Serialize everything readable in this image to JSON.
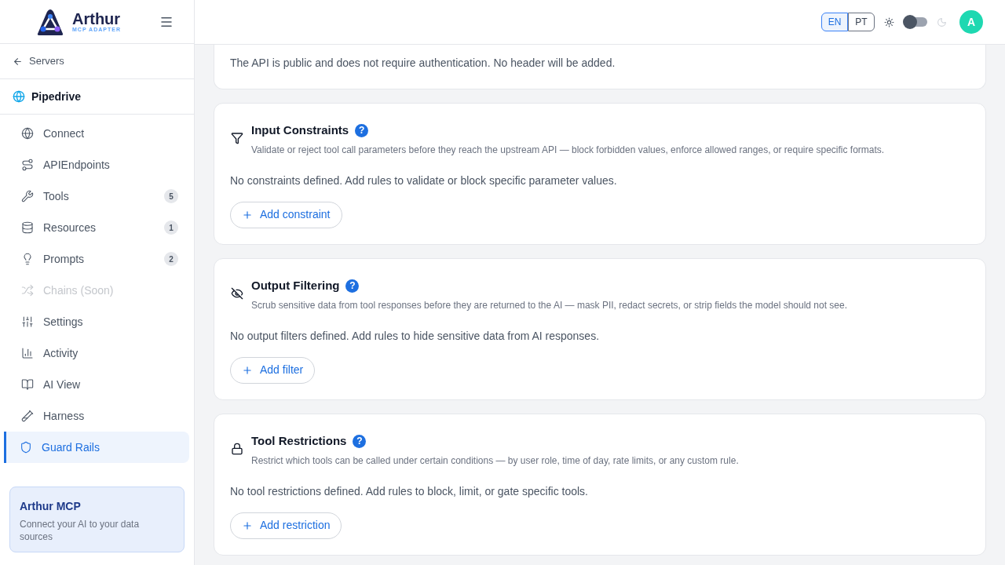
{
  "brand": {
    "name": "Arthur",
    "tagline": "MCP ADAPTER"
  },
  "back_link": "Servers",
  "server": {
    "name": "Pipedrive"
  },
  "nav": [
    {
      "label": "Connect",
      "selected": false,
      "disabled": false
    },
    {
      "label": "APIEndpoints",
      "selected": false,
      "disabled": false
    },
    {
      "label": "Tools",
      "count": "5",
      "selected": false,
      "disabled": false
    },
    {
      "label": "Resources",
      "count": "1",
      "selected": false,
      "disabled": false
    },
    {
      "label": "Prompts",
      "count": "2",
      "selected": false,
      "disabled": false
    },
    {
      "label": "Chains (Soon)",
      "selected": false,
      "disabled": true
    },
    {
      "label": "Settings",
      "selected": false,
      "disabled": false
    },
    {
      "label": "Activity",
      "selected": false,
      "disabled": false
    },
    {
      "label": "AI View",
      "selected": false,
      "disabled": false
    },
    {
      "label": "Harness",
      "selected": false,
      "disabled": false
    },
    {
      "label": "Guard Rails",
      "selected": true,
      "disabled": false
    }
  ],
  "promo": {
    "title": "Arthur MCP",
    "text": "Connect your AI to your data sources"
  },
  "languages": [
    {
      "label": "EN",
      "selected": true
    },
    {
      "label": "PT",
      "selected": false
    }
  ],
  "dark_mode": {
    "on": false
  },
  "avatar": "A",
  "auth_note": "The API is public and does not require authentication. No header will be added.",
  "sections": [
    {
      "title": "Input Constraints",
      "help": "?",
      "description": "Validate or reject tool call parameters before they reach the upstream API — block forbidden values, enforce allowed ranges, or require specific formats.",
      "empty": "No constraints defined. Add rules to validate or block specific parameter values.",
      "button": "Add constraint"
    },
    {
      "title": "Output Filtering",
      "help": "?",
      "description": "Scrub sensitive data from tool responses before they are returned to the AI — mask PII, redact secrets, or strip fields the model should not see.",
      "empty": "No output filters defined. Add rules to hide sensitive data from AI responses.",
      "button": "Add filter"
    },
    {
      "title": "Tool Restrictions",
      "help": "?",
      "description": "Restrict which tools can be called under certain conditions — by user role, time of day, rate limits, or any custom rule.",
      "empty": "No tool restrictions defined. Add rules to block, limit, or gate specific tools.",
      "button": "Add restriction"
    }
  ]
}
